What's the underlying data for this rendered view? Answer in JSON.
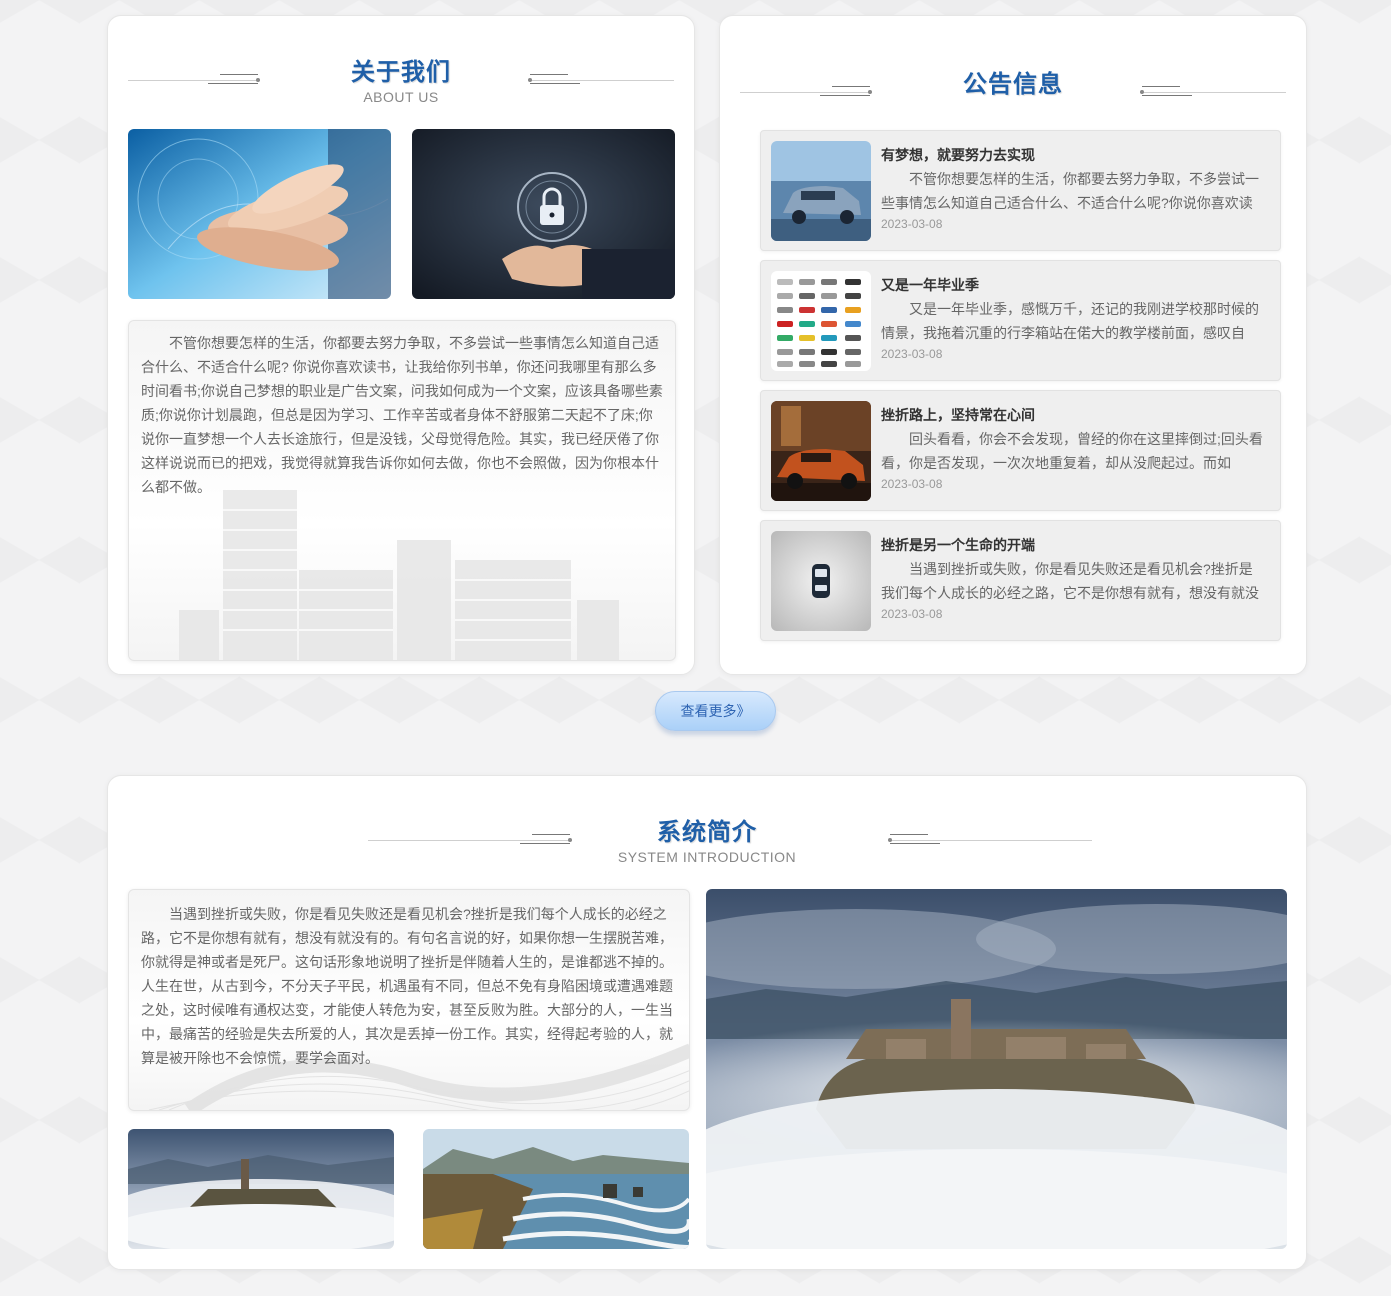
{
  "about": {
    "title": "关于我们",
    "subtitle": "ABOUT US",
    "text": "不管你想要怎样的生活，你都要去努力争取，不多尝试一些事情怎么知道自己适合什么、不适合什么呢? 你说你喜欢读书，让我给你列书单，你还问我哪里有那么多时间看书;你说自己梦想的职业是广告文案，问我如何成为一个文案，应该具备哪些素质;你说你计划晨跑，但总是因为学习、工作辛苦或者身体不舒服第二天起不了床;你说你一直梦想一个人去长途旅行，但是没钱，父母觉得危险。其实，我已经厌倦了你这样说说而已的把戏，我觉得就算我告诉你如何去做，你也不会照做，因为你根本什么都不做。"
  },
  "notice": {
    "title": "公告信息",
    "items": [
      {
        "title": "有梦想，就要努力去实现",
        "desc": "不管你想要怎样的生活，你都要去努力争取，不多尝试一些事情怎么知道自己适合什么、不适合什么呢?你说你喜欢读",
        "date": "2023-03-08"
      },
      {
        "title": "又是一年毕业季",
        "desc": "又是一年毕业季，感慨万千，还记的我刚进学校那时候的情景，我拖着沉重的行李箱站在偌大的教学楼前面，感叹自",
        "date": "2023-03-08"
      },
      {
        "title": "挫折路上，坚持常在心间",
        "desc": "回头看看，你会不会发现，曾经的你在这里摔倒过;回头看看，你是否发现，一次次地重复着，却从没爬起过。而如",
        "date": "2023-03-08"
      },
      {
        "title": "挫折是另一个生命的开端",
        "desc": "当遇到挫折或失败，你是看见失败还是看见机会?挫折是我们每个人成长的必经之路，它不是你想有就有，想没有就没",
        "date": "2023-03-08"
      }
    ]
  },
  "more_button": "查看更多》",
  "system": {
    "title": "系统简介",
    "subtitle": "SYSTEM INTRODUCTION",
    "text": "当遇到挫折或失败，你是看见失败还是看见机会?挫折是我们每个人成长的必经之路，它不是你想有就有，想没有就没有的。有句名言说的好，如果你想一生摆脱苦难，你就得是神或者是死尸。这句话形象地说明了挫折是伴随着人生的，是谁都逃不掉的。人生在世，从古到今，不分天子平民，机遇虽有不同，但总不免有身陷困境或遭遇难题之处，这时候唯有通权达变，才能使人转危为安，甚至反败为胜。大部分的人，一生当中，最痛苦的经验是失去所爱的人，其次是丢掉一份工作。其实，经得起考验的人，就算是被开除也不会惊慌，要学会面对。"
  },
  "colors": {
    "title_blue": "#1f5fa8",
    "button_blue": "#aad0f8"
  }
}
